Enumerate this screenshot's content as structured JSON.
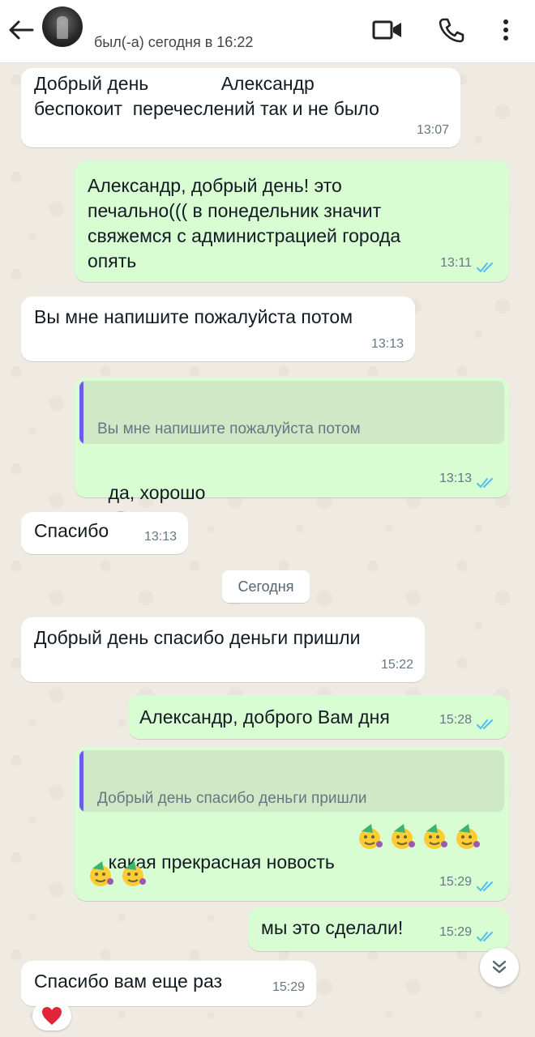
{
  "header": {
    "last_seen": "был(-а) сегодня в 16:22"
  },
  "icons": {
    "back": "arrow-left-icon",
    "video": "video-camera-icon",
    "call": "phone-icon",
    "menu": "more-vertical-icon",
    "read": "double-check-icon",
    "scroll": "chevron-double-down-icon",
    "reaction": "red-heart-icon",
    "handshake": "handshake-emoji",
    "party": "partying-face-emoji"
  },
  "colors": {
    "incoming_bubble": "#ffffff",
    "outgoing_bubble": "#d9fdd3",
    "read_ticks": "#53bdeb",
    "quote_bar": "#6c5ce7",
    "wallpaper": "#efeae2"
  },
  "messages": [
    {
      "dir": "in",
      "text": "Добрый день              Александр\nбеспокоит  перечеслений так и не было",
      "time": "13:07"
    },
    {
      "dir": "out",
      "text": "Александр, добрый день! это\nпечально((( в понедельник значит\nсвяжемся с администрацией города\nопять",
      "time": "13:11",
      "status": "read"
    },
    {
      "dir": "in",
      "text": "Вы мне напишите пожалуйста потом",
      "time": "13:13"
    },
    {
      "dir": "out",
      "quote": "Вы мне напишите пожалуйста потом",
      "text": "да, хорошо",
      "time": "13:13",
      "status": "read"
    },
    {
      "dir": "in",
      "text": "Спасибо",
      "time": "13:13"
    },
    {
      "dir": "in",
      "text": "Добрый день спасибо деньги пришли",
      "time": "15:22"
    },
    {
      "dir": "out",
      "text": "Александр, доброго Вам дня",
      "time": "15:28",
      "status": "read"
    },
    {
      "dir": "out",
      "quote": "Добрый день спасибо деньги пришли",
      "text": "какая прекрасная новость",
      "time": "15:29",
      "status": "read"
    },
    {
      "dir": "out",
      "text": "мы это сделали!",
      "time": "15:29",
      "status": "read"
    },
    {
      "dir": "in",
      "text": "Спасибо вам еще раз",
      "time": "15:29"
    }
  ],
  "date_separator": "Сегодня"
}
